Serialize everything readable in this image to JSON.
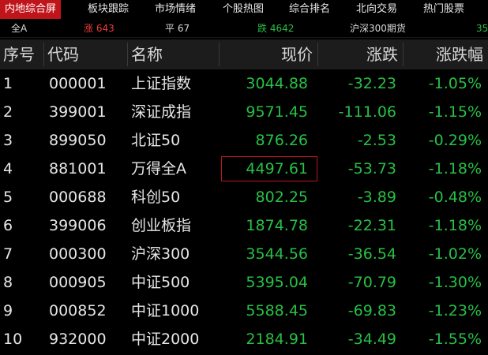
{
  "tabs": [
    {
      "label": "内地综合屏",
      "active": true
    },
    {
      "label": "板块跟踪",
      "active": false
    },
    {
      "label": "市场情绪",
      "active": false
    },
    {
      "label": "个股热图",
      "active": false
    },
    {
      "label": "综合排名",
      "active": false
    },
    {
      "label": "北向交易",
      "active": false
    },
    {
      "label": "热门股票",
      "active": false
    }
  ],
  "summary": {
    "market": "全A",
    "up": "涨 643",
    "flat": "平 67",
    "down": "跌 4642",
    "futures": "沪深300期货",
    "futures_value": "35"
  },
  "table": {
    "columns": [
      "序号",
      "代码",
      "名称",
      "现价",
      "涨跌",
      "涨跌幅"
    ],
    "highlighted_row": 3,
    "rows": [
      {
        "seq": "1",
        "code": "000001",
        "name": "上证指数",
        "price": "3044.88",
        "change": "-32.23",
        "pct": "-1.05%"
      },
      {
        "seq": "2",
        "code": "399001",
        "name": "深证成指",
        "price": "9571.45",
        "change": "-111.06",
        "pct": "-1.15%"
      },
      {
        "seq": "3",
        "code": "899050",
        "name": "北证50",
        "price": "876.26",
        "change": "-2.53",
        "pct": "-0.29%"
      },
      {
        "seq": "4",
        "code": "881001",
        "name": "万得全A",
        "price": "4497.61",
        "change": "-53.73",
        "pct": "-1.18%"
      },
      {
        "seq": "5",
        "code": "000688",
        "name": "科创50",
        "price": "802.25",
        "change": "-3.89",
        "pct": "-0.48%"
      },
      {
        "seq": "6",
        "code": "399006",
        "name": "创业板指",
        "price": "1874.78",
        "change": "-22.31",
        "pct": "-1.18%"
      },
      {
        "seq": "7",
        "code": "000300",
        "name": "沪深300",
        "price": "3544.56",
        "change": "-36.54",
        "pct": "-1.02%"
      },
      {
        "seq": "8",
        "code": "000905",
        "name": "中证500",
        "price": "5395.04",
        "change": "-70.79",
        "pct": "-1.30%"
      },
      {
        "seq": "9",
        "code": "000852",
        "name": "中证1000",
        "price": "5588.45",
        "change": "-69.83",
        "pct": "-1.23%"
      },
      {
        "seq": "10",
        "code": "932000",
        "name": "中证2000",
        "price": "2184.91",
        "change": "-34.49",
        "pct": "-1.55%"
      }
    ]
  },
  "colors": {
    "accent_red": "#c0141b",
    "up_red": "#f03a3a",
    "down_green": "#27c045",
    "header_bg": "#1c1c1c",
    "background": "#000000"
  }
}
